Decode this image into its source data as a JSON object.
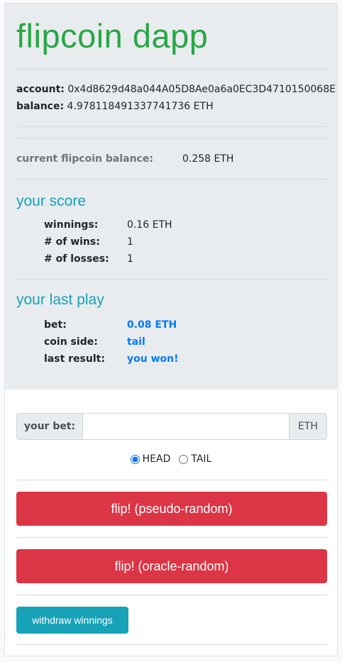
{
  "title": "flipcoin dapp",
  "account": {
    "label": "account:",
    "value": "0x4d8629d48a044A05D8Ae0a6a0EC3D4710150068E"
  },
  "balance": {
    "label": "balance:",
    "value": "4.978118491337741736 ETH"
  },
  "contract": {
    "label": "current flipcoin balance:",
    "value": "0.258 ETH"
  },
  "score": {
    "title": "your score",
    "winnings_label": "winnings:",
    "winnings": "0.16 ETH",
    "wins_label": "# of wins:",
    "wins": "1",
    "losses_label": "# of losses:",
    "losses": "1"
  },
  "last_play": {
    "title": "your last play",
    "bet_label": "bet:",
    "bet": "0.08 ETH",
    "side_label": "coin side:",
    "side": "tail",
    "result_label": "last result:",
    "result": "you won!"
  },
  "form": {
    "bet_label": "your bet:",
    "bet_value": "",
    "unit": "ETH",
    "options": [
      {
        "label": "HEAD",
        "checked": true
      },
      {
        "label": "TAIL",
        "checked": false
      }
    ]
  },
  "buttons": {
    "pseudo": "flip! (pseudo-random)",
    "oracle": "flip! (oracle-random)",
    "withdraw": "withdraw winnings"
  }
}
